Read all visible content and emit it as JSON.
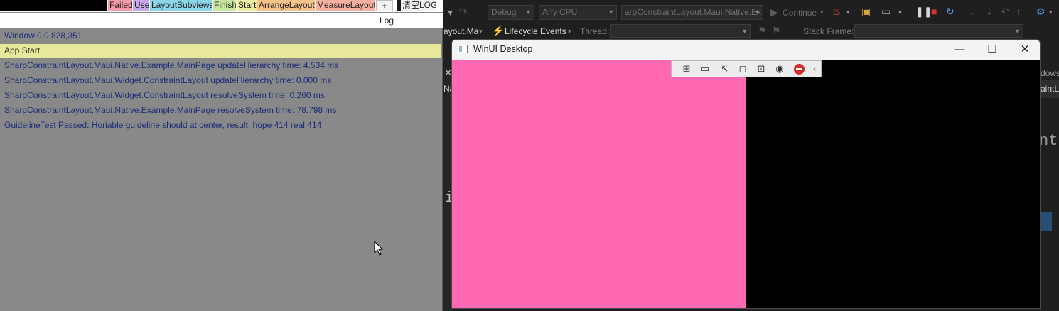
{
  "logapp": {
    "filters": [
      {
        "label": "Failed",
        "color": "#f59aa8"
      },
      {
        "label": "Use",
        "color": "#c8a8e8"
      },
      {
        "label": "LayoutSubviews",
        "color": "#8ad6e8"
      },
      {
        "label": "Finish",
        "color": "#c6e8a0"
      },
      {
        "label": "Start",
        "color": "#eef0a0"
      },
      {
        "label": "ArrangeLayout",
        "color": "#f7c388"
      },
      {
        "label": "MeasureLayout",
        "color": "#f7b0a0"
      }
    ],
    "add_label": "+",
    "clear_label": "清空LOG",
    "header": "Log",
    "lines": [
      "Window 0,0,828,351",
      "App Start",
      "SharpConstraintLayout.Maui.Native.Example.MainPage updateHierarchy time: 4.534 ms",
      "SharpConstraintLayout.Maui.Widget.ConstraintLayout updateHierarchy time: 0.000 ms",
      "SharpConstraintLayout.Maui.Widget.ConstraintLayout resolveSystem time: 0.260 ms",
      "SharpConstraintLayout.Maui.Native.Example.MainPage resolveSystem time: 78.798 ms",
      "GuidelineTest Passed: Horiable guideline should at center, result: hope 414 real 414"
    ]
  },
  "vs": {
    "config": "Debug",
    "platform": "Any CPU",
    "startup": "arpConstraintLayout.Maui.Native.Ex",
    "continue_label": "Continue",
    "project_fragment": "ayout.Ma",
    "lifecycle_label": "Lifecycle Events",
    "thread_label": "Thread:",
    "stackframe_label": "Stack Frame:",
    "side_fragment_1": "Na",
    "side_fragment_2": "dows",
    "side_fragment_3": "aintL",
    "code_fragment": "nt",
    "code_fragment_2": "i"
  },
  "winui": {
    "title": "WinUI Desktop",
    "minimize": "—",
    "maximize": "☐",
    "close": "✕",
    "pink_color": "#ff69b4"
  }
}
